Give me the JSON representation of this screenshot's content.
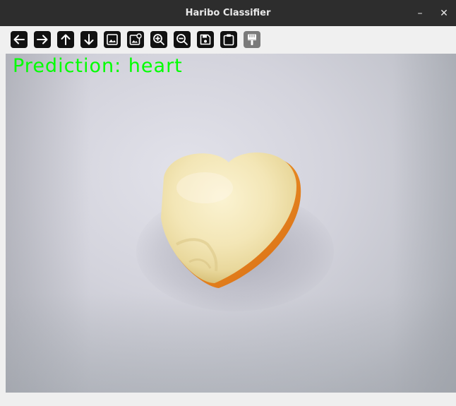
{
  "window": {
    "title": "Haribo Classifier",
    "minimize_label": "–",
    "close_label": "✕"
  },
  "toolbar": {
    "tools": [
      {
        "name": "arrow-left-icon"
      },
      {
        "name": "arrow-right-icon"
      },
      {
        "name": "arrow-up-icon"
      },
      {
        "name": "arrow-down-icon"
      },
      {
        "name": "image-icon"
      },
      {
        "name": "image-properties-icon"
      },
      {
        "name": "zoom-in-icon"
      },
      {
        "name": "zoom-out-icon"
      },
      {
        "name": "save-icon"
      },
      {
        "name": "clipboard-icon"
      },
      {
        "name": "paint-brush-icon"
      }
    ]
  },
  "viewport": {
    "prediction_text": "Prediction: heart",
    "prediction_color": "#00ff00"
  }
}
